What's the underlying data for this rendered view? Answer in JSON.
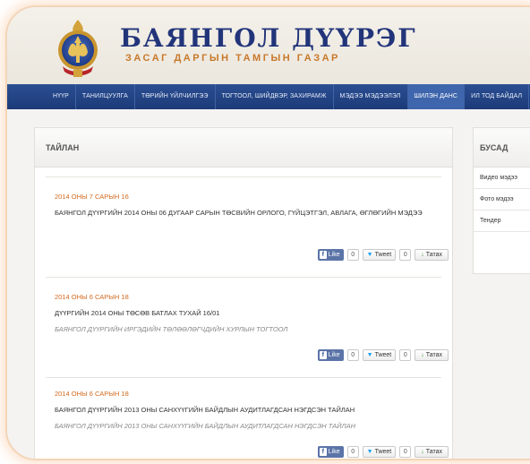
{
  "header": {
    "title": "БАЯНГОЛ ДҮҮРЭГ",
    "subtitle": "ЗАСАГ ДАРГЫН ТАМГЫН ГАЗАР"
  },
  "nav": {
    "items": [
      "НҮҮР",
      "ТАНИЛЦУУЛГА",
      "ТӨРИЙН ҮЙЛЧИЛГЭЭ",
      "ТОГТООЛ, ШИЙДВЭР, ЗАХИРАМЖ",
      "МЭДЭЭ МЭДЭЭЛЭЛ",
      "ШИЛЭН ДАНС",
      "ИЛ ТОД БАЙДАЛ"
    ],
    "active_index": 5
  },
  "main": {
    "heading": "ТАЙЛАН",
    "entries": [
      {
        "date": "2014 ОНЫ 7 САРЫН 16",
        "title": "БАЯНГОЛ ДҮҮРГИЙН 2014 ОНЫ 06 ДУГААР САРЫН ТӨСВИЙН ОРЛОГО, ГҮЙЦЭТГЭЛ, АВЛАГА, ӨГЛӨГИЙН МЭДЭЭ",
        "subtitle": ""
      },
      {
        "date": "2014 ОНЫ 6 САРЫН 18",
        "title": "ДҮҮРГИЙН 2014 ОНЫ ТӨСӨВ БАТЛАХ ТУХАЙ 16/01",
        "subtitle": "БАЯНГОЛ ДҮҮРГИЙН ИРГЭДИЙН ТӨЛӨӨЛӨГЧДИЙН ХУРЛЫН ТОГТООЛ"
      },
      {
        "date": "2014 ОНЫ 6 САРЫН 18",
        "title": "БАЯНГОЛ ДҮҮРГИЙН 2013 ОНЫ САНХҮҮГИЙН БАЙДЛЫН АУДИТЛАГДСАН НЭГДСЭН ТАЙЛАН",
        "subtitle": "БАЯНГОЛ ДҮҮРГИЙН 2013 ОНЫ САНХҮҮГИЙН БАЙДЛЫН АУДИТЛАГДСАН НЭГДСЭН ТАЙЛАН"
      }
    ],
    "share": {
      "like_label": "Like",
      "like_count": "0",
      "tweet_label": "Tweet",
      "tweet_count": "0",
      "download_label": "Татах"
    }
  },
  "side": {
    "heading": "БУСАД",
    "items": [
      "Видео мэдээ",
      "Фото мэдээ",
      "Тендер"
    ]
  },
  "colors": {
    "nav_bg": "#1c3a78",
    "title_blue": "#22357a",
    "accent_orange": "#d2691e"
  }
}
